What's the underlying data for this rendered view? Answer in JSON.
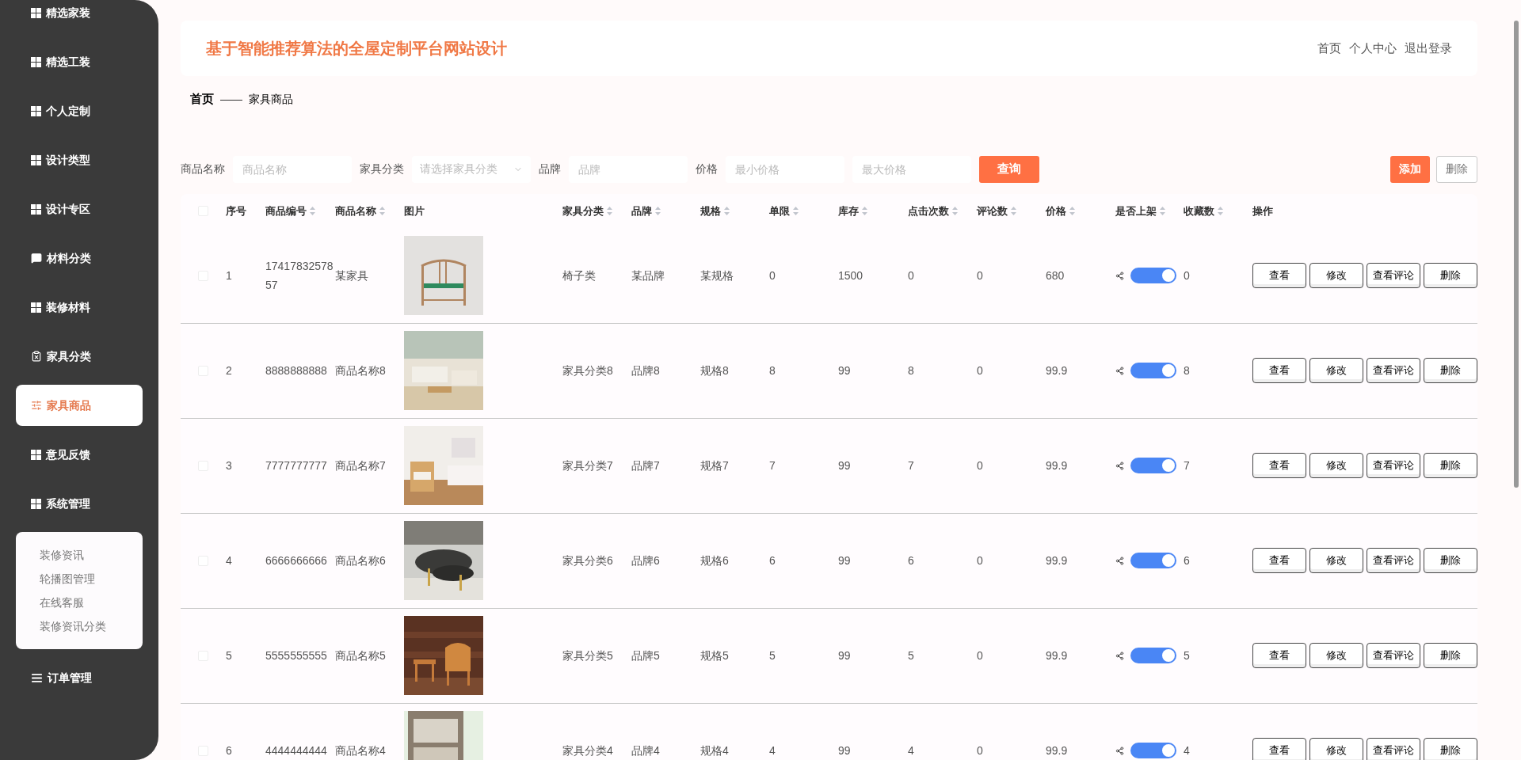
{
  "sidebar": {
    "items": [
      {
        "label": "精选家装",
        "kind": "grid",
        "selected": false
      },
      {
        "label": "精选工装",
        "kind": "grid",
        "selected": false
      },
      {
        "label": "个人定制",
        "kind": "grid",
        "selected": false
      },
      {
        "label": "设计类型",
        "kind": "grid",
        "selected": false
      },
      {
        "label": "设计专区",
        "kind": "grid",
        "selected": false
      },
      {
        "label": "材料分类",
        "kind": "chat",
        "selected": false
      },
      {
        "label": "装修材料",
        "kind": "grid",
        "selected": false
      },
      {
        "label": "家具分类",
        "kind": "clipboard",
        "selected": false
      },
      {
        "label": "家具商品",
        "kind": "sliders",
        "selected": true
      },
      {
        "label": "意见反馈",
        "kind": "grid",
        "selected": false
      },
      {
        "label": "系统管理",
        "kind": "grid",
        "selected": false,
        "expanded": true,
        "children": [
          {
            "label": "装修资讯"
          },
          {
            "label": "轮播图管理"
          },
          {
            "label": "在线客服"
          },
          {
            "label": "装修资讯分类"
          }
        ]
      },
      {
        "label": "订单管理",
        "kind": "list",
        "selected": false
      }
    ]
  },
  "header": {
    "title": "基于智能推荐算法的全屋定制平台网站设计",
    "links": [
      "首页",
      "个人中心",
      "退出登录"
    ]
  },
  "breadcrumb": {
    "home": "首页",
    "separator": "——",
    "current": "家具商品"
  },
  "filters": [
    {
      "kind": "input",
      "label": "商品名称",
      "placeholder": "商品名称"
    },
    {
      "kind": "select",
      "label": "家具分类",
      "placeholder": "请选择家具分类"
    },
    {
      "kind": "input",
      "label": "品牌",
      "placeholder": "品牌"
    },
    {
      "kind": "input",
      "label": "价格",
      "placeholder": "最小价格"
    },
    {
      "kind": "input",
      "placeholder": "最大价格"
    }
  ],
  "search_button": "查询",
  "toolbar": {
    "add": "添加",
    "delete": "删除"
  },
  "table": {
    "columns": [
      {
        "label": "序号",
        "sortable": false
      },
      {
        "label": "商品编号",
        "sortable": true
      },
      {
        "label": "商品名称",
        "sortable": true
      },
      {
        "label": "图片",
        "sortable": false
      },
      {
        "label": "家具分类",
        "sortable": true
      },
      {
        "label": "品牌",
        "sortable": true
      },
      {
        "label": "规格",
        "sortable": true
      },
      {
        "label": "单限",
        "sortable": true
      },
      {
        "label": "库存",
        "sortable": true
      },
      {
        "label": "点击次数",
        "sortable": true
      },
      {
        "label": "评论数",
        "sortable": true
      },
      {
        "label": "价格",
        "sortable": true
      },
      {
        "label": "是否上架",
        "sortable": true
      },
      {
        "label": "收藏数",
        "sortable": true
      },
      {
        "label": "操作",
        "sortable": false
      }
    ],
    "select_all": {
      "checked": false
    },
    "rows": [
      {
        "checked": false,
        "index": "1",
        "code": "1741783257857",
        "name": "某家具",
        "category": "椅子类",
        "brand": "某品牌",
        "spec": "某规格",
        "limit": "0",
        "stock": "1500",
        "clicks": "0",
        "comments": "0",
        "price": "680",
        "on": true,
        "favorites": "0",
        "actions": [
          "查看",
          "修改",
          "查看评论",
          "删除"
        ]
      },
      {
        "checked": false,
        "index": "2",
        "code": "8888888888",
        "name": "商品名称8",
        "category": "家具分类8",
        "brand": "品牌8",
        "spec": "规格8",
        "limit": "8",
        "stock": "99",
        "clicks": "8",
        "comments": "0",
        "price": "99.9",
        "on": true,
        "favorites": "8",
        "actions": [
          "查看",
          "修改",
          "查看评论",
          "删除"
        ]
      },
      {
        "checked": false,
        "index": "3",
        "code": "7777777777",
        "name": "商品名称7",
        "category": "家具分类7",
        "brand": "品牌7",
        "spec": "规格7",
        "limit": "7",
        "stock": "99",
        "clicks": "7",
        "comments": "0",
        "price": "99.9",
        "on": true,
        "favorites": "7",
        "actions": [
          "查看",
          "修改",
          "查看评论",
          "删除"
        ]
      },
      {
        "checked": false,
        "index": "4",
        "code": "6666666666",
        "name": "商品名称6",
        "category": "家具分类6",
        "brand": "品牌6",
        "spec": "规格6",
        "limit": "6",
        "stock": "99",
        "clicks": "6",
        "comments": "0",
        "price": "99.9",
        "on": true,
        "favorites": "6",
        "actions": [
          "查看",
          "修改",
          "查看评论",
          "删除"
        ]
      },
      {
        "checked": false,
        "index": "5",
        "code": "5555555555",
        "name": "商品名称5",
        "category": "家具分类5",
        "brand": "品牌5",
        "spec": "规格5",
        "limit": "5",
        "stock": "99",
        "clicks": "5",
        "comments": "0",
        "price": "99.9",
        "on": true,
        "favorites": "5",
        "actions": [
          "查看",
          "修改",
          "查看评论",
          "删除"
        ]
      },
      {
        "checked": false,
        "index": "6",
        "code": "4444444444",
        "name": "商品名称4",
        "category": "家具分类4",
        "brand": "品牌4",
        "spec": "规格4",
        "limit": "4",
        "stock": "99",
        "clicks": "4",
        "comments": "0",
        "price": "99.9",
        "on": true,
        "favorites": "4",
        "actions": [
          "查看",
          "修改",
          "查看评论",
          "删除"
        ]
      }
    ]
  }
}
